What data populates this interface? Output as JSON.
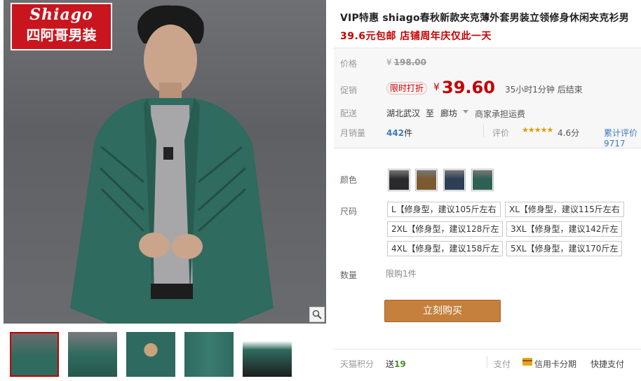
{
  "brand": {
    "name_en": "Shiago",
    "name_cn": "四阿哥男装"
  },
  "product": {
    "title": "VIP特惠 shiago春秋新款夹克薄外套男装立领修身休闲夹克衫男",
    "promo_line": "39.6元包邮 店铺周年庆仅此一天"
  },
  "pricing": {
    "original_label": "价格",
    "currency": "¥",
    "original_price": "198.00",
    "promo_label": "促销",
    "promo_tag": "限时打折",
    "price": "39.60",
    "countdown": "35小时1分钟 后结束"
  },
  "shipping": {
    "label": "配送",
    "from": "湖北武汉",
    "to_word": "至",
    "destination": "廊坊",
    "fee_note": "商家承担运费"
  },
  "sales": {
    "label": "月销量",
    "count": "442",
    "unit": "件",
    "review_label": "评价",
    "stars": "★★★★★",
    "rating": "4.6分",
    "review_text": "累计评价9717"
  },
  "options": {
    "color_label": "颜色",
    "colors": [
      {
        "name": "black",
        "hex": "#2a2a2c"
      },
      {
        "name": "khaki",
        "hex": "#7a5a2e"
      },
      {
        "name": "navy",
        "hex": "#2c3f55"
      },
      {
        "name": "green",
        "hex": "#2e6156"
      }
    ],
    "size_label": "尺码",
    "sizes": [
      "L【修身型，建议105斤左右",
      "XL【修身型，建议115斤左右",
      "2XL【修身型，建议128斤左",
      "3XL【修身型，建议142斤左",
      "4XL【修身型，建议158斤左",
      "5XL【修身型，建议170斤左"
    ],
    "qty_label": "数量",
    "qty_note": "限购1件"
  },
  "buy_button": "立刻购买",
  "footer": {
    "points_label": "天猫积分",
    "points_prefix": "送",
    "points": "19",
    "pay_label": "支付",
    "pay_card": "信用卡分期",
    "pay_quick": "快捷支付"
  },
  "colors": {
    "accent_red": "#c40000",
    "buy_button": "#c4803c",
    "link_blue": "#3c7bc0"
  }
}
